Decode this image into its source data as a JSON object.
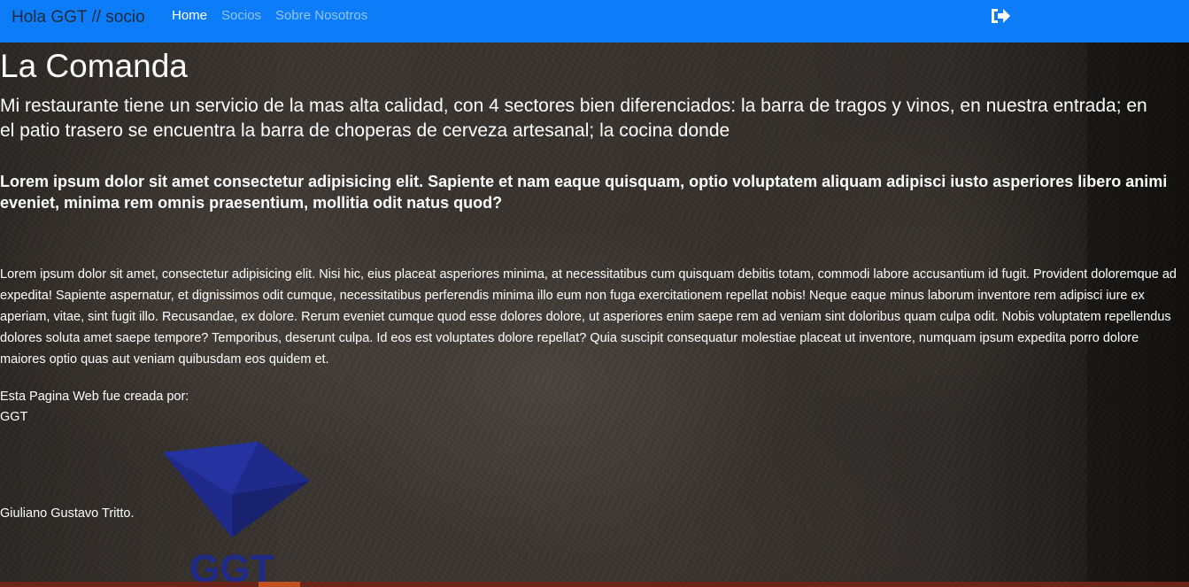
{
  "navbar": {
    "brand": "Hola GGT // socio",
    "links": [
      {
        "label": "Home",
        "active": true
      },
      {
        "label": "Socios",
        "active": false
      },
      {
        "label": "Sobre Nosotros",
        "active": false
      }
    ],
    "logout_icon": "sign-out-icon",
    "color": "#0d7cf8"
  },
  "main": {
    "title": "La Comanda",
    "subtitle": "Mi restaurante tiene un servicio de la mas alta calidad, con 4 sectores bien diferenciados: la barra de tragos y vinos, en nuestra entrada; en el patio trasero se encuentra la barra de choperas de cerveza artesanal; la cocina donde",
    "lead": "Lorem ipsum dolor sit amet consectetur adipisicing elit. Sapiente et nam eaque quisquam, optio voluptatem aliquam adipisci iusto asperiores libero animi eveniet, minima rem omnis praesentium, mollitia odit natus quod?",
    "body": "Lorem ipsum dolor sit amet, consectetur adipisicing elit. Nisi hic, eius placeat asperiores minima, at necessitatibus cum quisquam debitis totam, commodi labore accusantium id fugit. Provident doloremque ad expedita! Sapiente aspernatur, et dignissimos odit cumque, necessitatibus perferendis minima illo eum non fuga exercitationem repellat nobis! Neque eaque minus laborum inventore rem adipisci iure ex aperiam, vitae, sint fugit illo. Recusandae, ex dolore. Rerum eveniet cumque quod esse dolores dolore, ut asperiores enim saepe rem ad veniam sint doloribus quam culpa odit. Nobis voluptatem repellendus dolores soluta amet saepe tempore? Temporibus, deserunt culpa. Id eos est voluptates dolore repellat? Quia suscipit consequatur molestiae placeat ut inventore, numquam ipsum expedita porro dolore maiores optio quas aut veniam quibusdam eos quidem et."
  },
  "credits": {
    "label": "Esta Pagina Web fue creada por:",
    "name": "GGT",
    "author": "Giuliano Gustavo Tritto.",
    "logo_text": "GGT",
    "logo_color": "#1f2a8a"
  }
}
